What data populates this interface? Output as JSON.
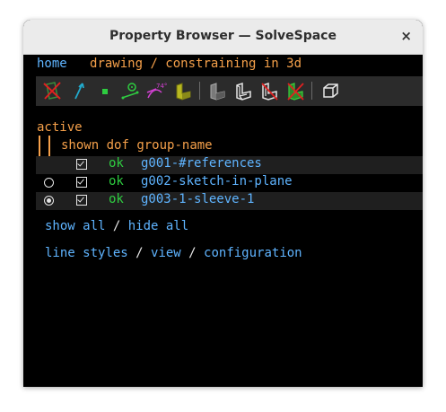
{
  "window": {
    "title": "Property Browser — SolveSpace",
    "close_glyph": "×"
  },
  "nav": {
    "home": "home",
    "drawing": "drawing / constraining in 3d"
  },
  "toolbar": {
    "icons": [
      "hide-workplane-icon",
      "show-normals-icon",
      "show-points-icon",
      "show-construction-icon",
      "show-constraints-icon",
      "show-faces-icon",
      "shaded-solid-icon",
      "wireframe-icon",
      "outline-icon",
      "hidden-lines-icon",
      "mesh-icon",
      "iso-view-icon"
    ],
    "dimension_label": "74°"
  },
  "section": {
    "active": "active",
    "shown": "shown",
    "dof": "dof",
    "group_name": "group-name"
  },
  "groups": [
    {
      "dof": "ok",
      "name": "g001-#references",
      "radio": "none"
    },
    {
      "dof": "ok",
      "name": "g002-sketch-in-plane",
      "radio": "empty"
    },
    {
      "dof": "ok",
      "name": "g003-1-sleeve-1",
      "radio": "selected"
    }
  ],
  "links": {
    "show_all": "show all",
    "sep": " / ",
    "hide_all": "hide all",
    "line_styles": "line styles",
    "view": "view",
    "configuration": "configuration"
  },
  "colors": {
    "accent": "#5fb4ff",
    "orange": "#f5a04a",
    "ok": "#2ecc40"
  }
}
